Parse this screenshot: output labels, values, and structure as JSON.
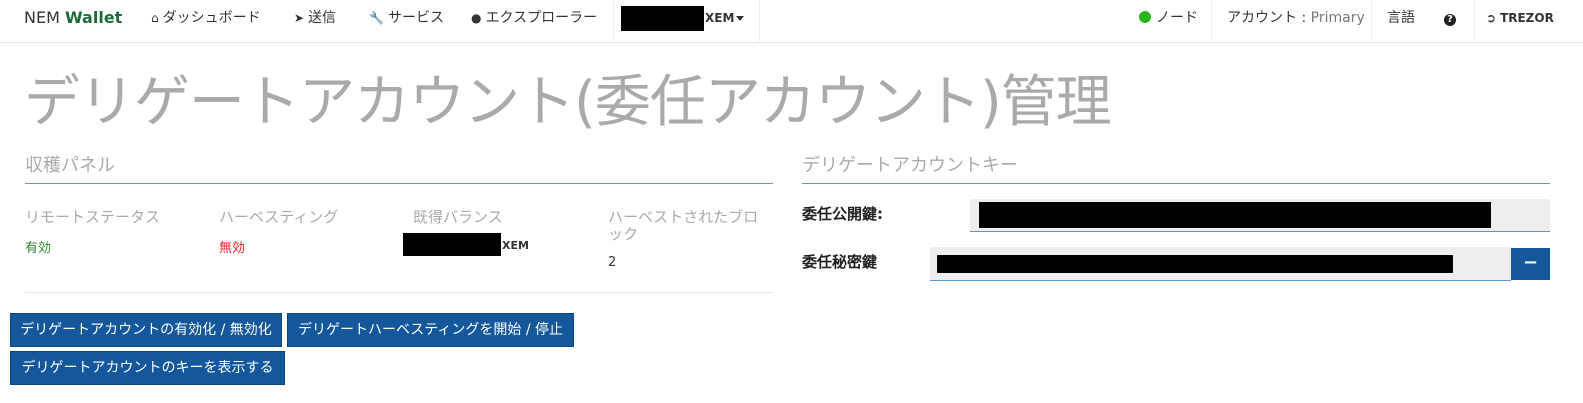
{
  "navbar": {
    "brand_plain": "NEM ",
    "brand_accent": "Wallet",
    "dashboard": "ダッシュボード",
    "send": "送信",
    "services": "サービス",
    "explorer": "エクスプローラー",
    "balance_unit": "XEM",
    "node": "ノード",
    "account_label": "アカウント : ",
    "account_name": "Primary",
    "language": "言語",
    "help_icon": "?",
    "trezor": "TREZOR",
    "node_status_color": "#2bb51a"
  },
  "page": {
    "title": "デリゲートアカウント(委任アカウント)管理"
  },
  "harvest_panel": {
    "heading": "収穫パネル",
    "remote_status_label": "リモートステータス",
    "remote_status_value": "有効",
    "harvesting_label": "ハーベスティング",
    "harvesting_value": "無効",
    "vested_balance_label": "既得バランス",
    "vested_balance_unit": "XEM",
    "harvested_blocks_label_1": "ハーベストされたブロ",
    "harvested_blocks_label_2": "ック",
    "harvested_blocks_value": "2",
    "btn_toggle_delegate": "デリゲートアカウントの有効化 / 無効化",
    "btn_toggle_harvest": "デリゲートハーベスティングを開始 / 停止",
    "btn_show_keys": "デリゲートアカウントのキーを表示する"
  },
  "delegate_keys": {
    "heading": "デリゲートアカウントキー",
    "public_key_label": "委任公開鍵:",
    "private_key_label": "委任秘密鍵",
    "hide_button": "−"
  },
  "colors": {
    "accent_blue": "#14579b",
    "brand_green": "#1d6b3a",
    "active_green": "#2e8b2e",
    "inactive_red": "#e02525"
  }
}
